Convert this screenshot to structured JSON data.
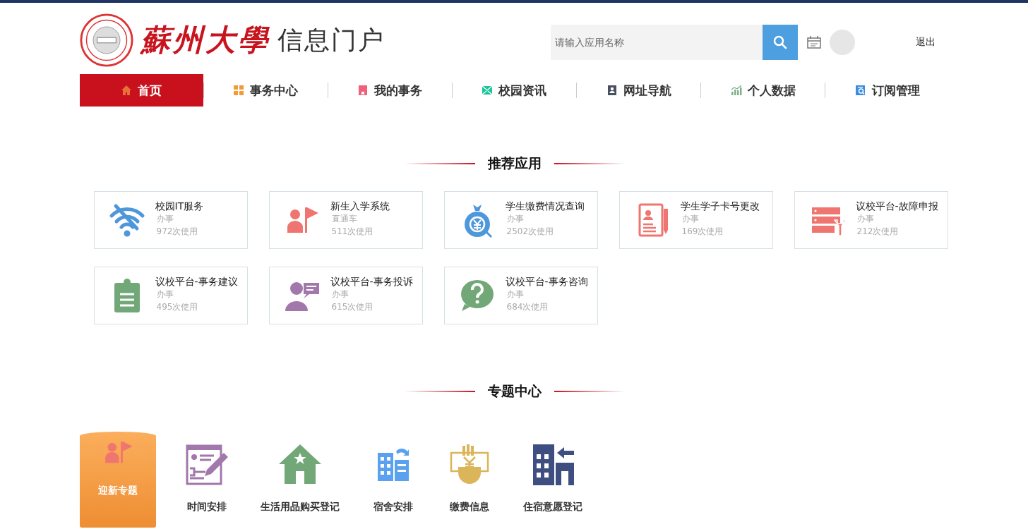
{
  "header": {
    "logo_text": "蘇州大學",
    "portal_title": "信息门户",
    "search": {
      "placeholder": "请输入应用名称"
    },
    "logout": "退出"
  },
  "nav": [
    {
      "label": "首页",
      "kind": "home",
      "color": "#e8703a",
      "selected": true
    },
    {
      "label": "事务中心",
      "kind": "grid",
      "color": "#f29a38",
      "selected": false
    },
    {
      "label": "我的事务",
      "kind": "book",
      "color": "#f0607a",
      "selected": false
    },
    {
      "label": "校园资讯",
      "kind": "envelope",
      "color": "#1bc49a",
      "selected": false
    },
    {
      "label": "网址导航",
      "kind": "contact",
      "color": "#4a5060",
      "selected": false
    },
    {
      "label": "个人数据",
      "kind": "chart",
      "color": "#7fb08a",
      "selected": false
    },
    {
      "label": "订阅管理",
      "kind": "doc",
      "color": "#3a8ee0",
      "selected": false
    }
  ],
  "recommended": {
    "title": "推荐应用",
    "apps": [
      {
        "name": "校园IT服务",
        "category": "办事",
        "usage": "972次使用",
        "kind": "wifi",
        "color": "#4f97db"
      },
      {
        "name": "新生入学系统",
        "category": "直通车",
        "usage": "511次使用",
        "kind": "flag",
        "color": "#ef7570"
      },
      {
        "name": "学生缴费情况查询",
        "category": "办事",
        "usage": "2502次使用",
        "kind": "moneybag",
        "color": "#4f97db"
      },
      {
        "name": "学生学子卡号更改",
        "category": "办事",
        "usage": "169次使用",
        "kind": "profile",
        "color": "#ef7570"
      },
      {
        "name": "议校平台-故障申报",
        "category": "办事",
        "usage": "212次使用",
        "kind": "server",
        "color": "#ef7570"
      },
      {
        "name": "议校平台-事务建议",
        "category": "办事",
        "usage": "495次使用",
        "kind": "clipboard",
        "color": "#72a878"
      },
      {
        "name": "议校平台-事务投诉",
        "category": "办事",
        "usage": "615次使用",
        "kind": "person",
        "color": "#a277ab"
      },
      {
        "name": "议校平台-事务咨询",
        "category": "办事",
        "usage": "684次使用",
        "kind": "question",
        "color": "#72a878"
      }
    ]
  },
  "topics": {
    "title": "专题中心",
    "items": [
      {
        "label": "迎新专题",
        "kind": "flag",
        "color": "#ef7570",
        "selected": true
      },
      {
        "label": "时间安排",
        "kind": "form",
        "color": "#a277ab",
        "selected": false
      },
      {
        "label": "生活用品购买登记",
        "kind": "house",
        "color": "#72a878",
        "selected": false
      },
      {
        "label": "宿舍安排",
        "kind": "building",
        "color": "#5aa2f0",
        "selected": false
      },
      {
        "label": "缴费信息",
        "kind": "hand",
        "color": "#dbb55a",
        "selected": false
      },
      {
        "label": "住宿意愿登记",
        "kind": "building2",
        "color": "#3f4e80",
        "selected": false
      }
    ]
  }
}
